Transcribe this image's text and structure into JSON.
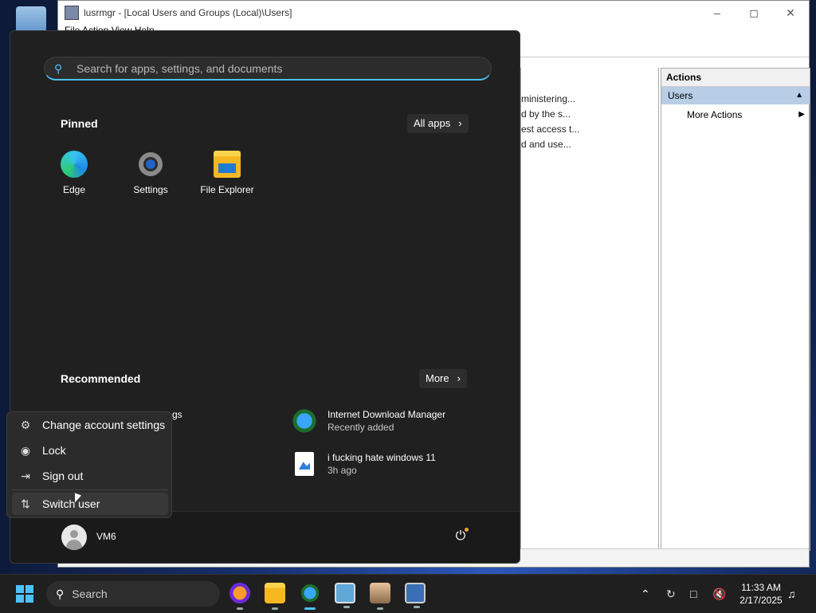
{
  "window": {
    "title": "lusrmgr - [Local Users and Groups (Local)\\Users]",
    "menu": "File  Action  View  Help",
    "list_rows": [
      "ministering...",
      "d by the s...",
      "est access t...",
      "d and use..."
    ],
    "actions_header": "Actions",
    "actions_selected": "Users",
    "actions_more": "More Actions"
  },
  "start_menu": {
    "search_placeholder": "Search for apps, settings, and documents",
    "pinned_title": "Pinned",
    "all_apps_label": "All apps",
    "pinned_apps": [
      {
        "label": "Edge",
        "icon": "edge-icon"
      },
      {
        "label": "Settings",
        "icon": "gear-icon"
      },
      {
        "label": "File Explorer",
        "icon": "folder-icon"
      }
    ],
    "recommended_title": "Recommended",
    "more_label": "More",
    "recommended": [
      {
        "title": "Internet Download Manager",
        "subtitle": "Recently added",
        "icon": "idm-icon"
      },
      {
        "title": "i fucking hate windows 11",
        "subtitle": "3h ago",
        "icon": "image-file-icon"
      }
    ],
    "hidden_recommended_fragment": "gs",
    "user_name": "VM6"
  },
  "account_flyout": {
    "items": [
      {
        "label": "Change account settings",
        "icon": "person-gear-icon"
      },
      {
        "label": "Lock",
        "icon": "lock-icon"
      },
      {
        "label": "Sign out",
        "icon": "sign-out-icon"
      },
      {
        "label": "Switch user",
        "icon": "switch-user-icon"
      }
    ]
  },
  "taskbar": {
    "search_label": "Search",
    "time": "11:33 AM",
    "date": "2/17/2025"
  },
  "colors": {
    "accent": "#4cc2ff",
    "start_bg": "#202020",
    "flyout_bg": "#2b2b2b",
    "actions_selected": "#b8cde6"
  }
}
